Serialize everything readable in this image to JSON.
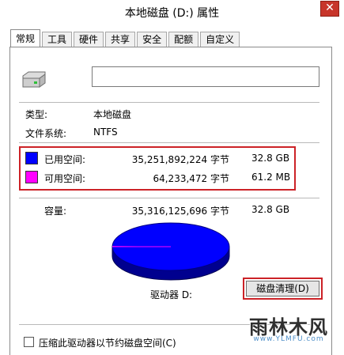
{
  "window": {
    "title": "本地磁盘 (D:) 属性"
  },
  "tabs": [
    {
      "label": "常规",
      "active": true
    },
    {
      "label": "工具"
    },
    {
      "label": "硬件"
    },
    {
      "label": "共享"
    },
    {
      "label": "安全"
    },
    {
      "label": "配额"
    },
    {
      "label": "自定义"
    }
  ],
  "general": {
    "name_value": "",
    "type_label": "类型:",
    "type_value": "本地磁盘",
    "fs_label": "文件系统:",
    "fs_value": "NTFS",
    "used": {
      "label": "已用空间:",
      "bytes": "35,251,892,224 字节",
      "size": "32.8 GB",
      "color": "#0000ff"
    },
    "free": {
      "label": "可用空间:",
      "bytes": "64,233,472 字节",
      "size": "61.2 MB",
      "color": "#ff00ff"
    },
    "capacity": {
      "label": "容量:",
      "bytes": "35,316,125,696 字节",
      "size": "32.8 GB"
    },
    "drive_label": "驱动器 D:",
    "cleanup_button": "磁盘清理(D)",
    "compress_checkbox": "压缩此驱动器以节约磁盘空间(C)",
    "compress_checked": false,
    "used_fraction": 0.998
  },
  "watermark": {
    "main": "雨林木风",
    "url": "www.YLMFU.com"
  }
}
